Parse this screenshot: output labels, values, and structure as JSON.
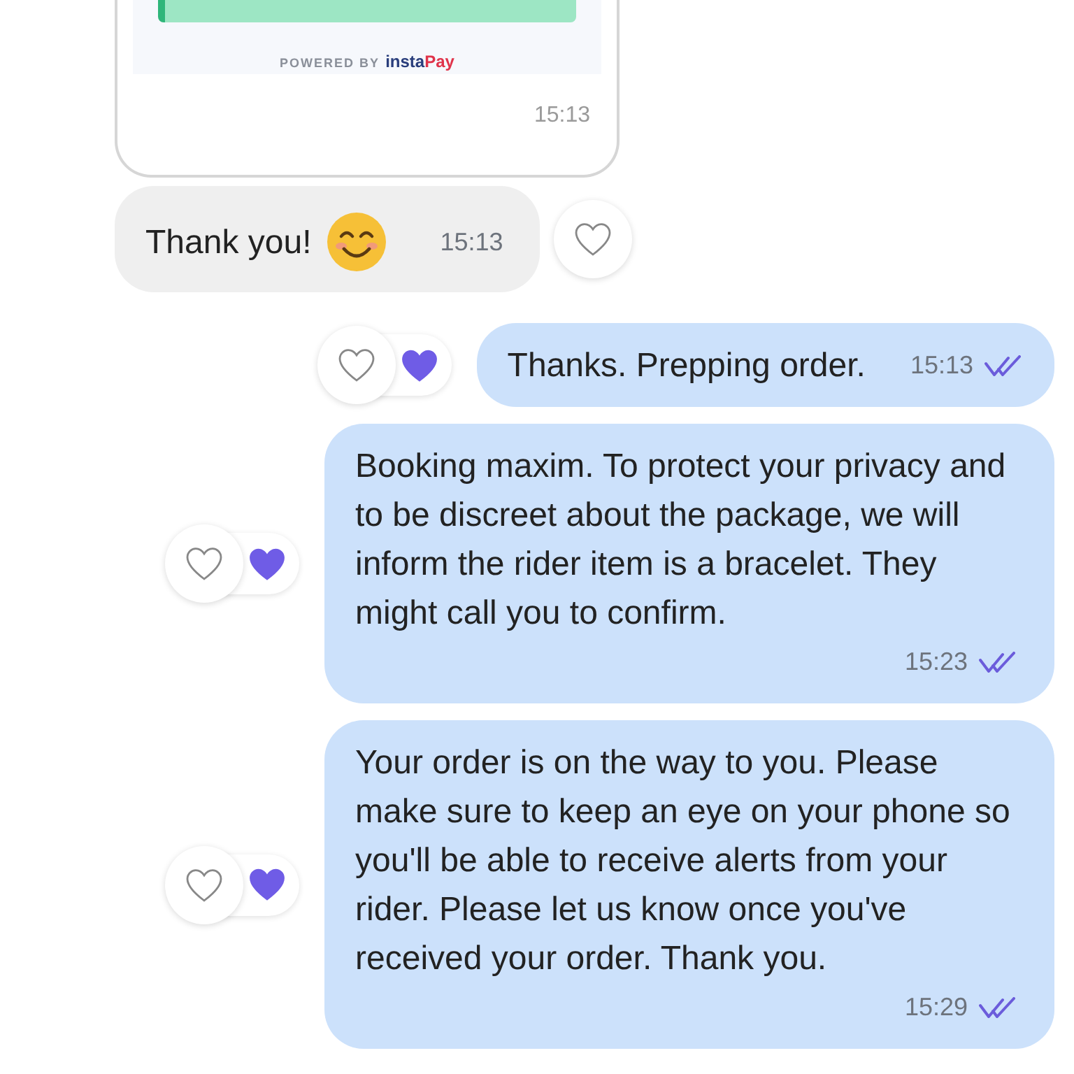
{
  "payment_card": {
    "powered_by": "POWERED BY",
    "brand_prefix": "insta",
    "brand_suffix": "Pay",
    "time": "15:13"
  },
  "messages": [
    {
      "kind": "received",
      "text": "Thank you!",
      "time": "15:13",
      "liked": false
    },
    {
      "kind": "sent",
      "text": "Thanks. Prepping order.",
      "time": "15:13",
      "read": true,
      "liked": true
    },
    {
      "kind": "sent",
      "text": "Booking maxim. To protect your privacy and to be discreet about the package, we will inform the rider item is a bracelet. They might call you to confirm.",
      "time": "15:23",
      "read": true,
      "liked": true
    },
    {
      "kind": "sent",
      "text": "Your order is on the way to you. Please make sure to keep an eye on your phone so you'll be able to receive alerts from your rider. Please let us know once you've received your order. Thank you.",
      "time": "15:29",
      "read": true,
      "liked": true
    }
  ]
}
